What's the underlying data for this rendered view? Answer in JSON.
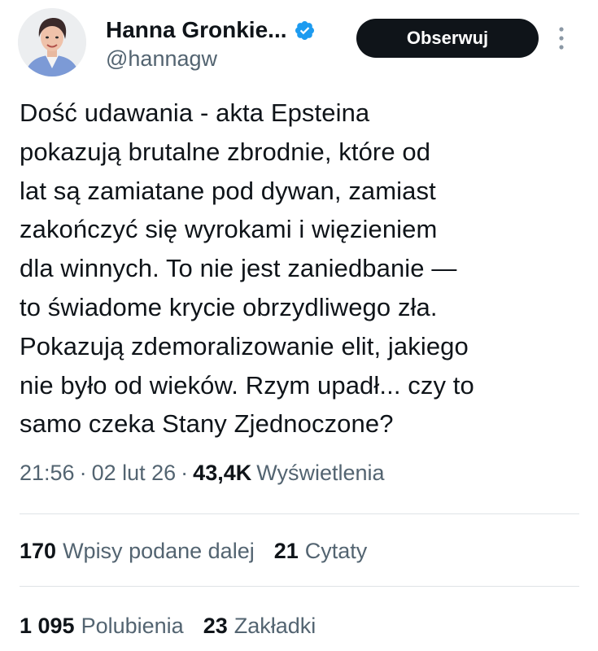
{
  "author": {
    "display_name": "Hanna Gronkie...",
    "handle": "@hannagw",
    "verified_icon": "verified-badge-icon",
    "avatar": "avatar"
  },
  "actions": {
    "follow_label": "Obserwuj",
    "more_icon": "more-vertical-icon"
  },
  "tweet": {
    "lines": [
      "Dość udawania - akta Epsteina",
      "pokazują brutalne zbrodnie, które od",
      "lat są zamiatane pod dywan, zamiast",
      "zakończyć się wyrokami i więzieniem",
      "dla winnych. To nie jest zaniedbanie —",
      "to świadome krycie obrzydliwego zła.",
      "Pokazują zdemoralizowanie elit, jakiego",
      "nie było od wieków. Rzym upadł... czy to",
      "samo czeka Stany Zjednoczone?"
    ]
  },
  "meta": {
    "time": "21:56",
    "separator": "·",
    "date": "02 lut 26",
    "views_count": "43,4K",
    "views_label": "Wyświetlenia"
  },
  "stats": {
    "reposts_count": "170",
    "reposts_label": "Wpisy podane dalej",
    "quotes_count": "21",
    "quotes_label": "Cytaty",
    "likes_count": "1 095",
    "likes_label": "Polubienia",
    "bookmarks_count": "23",
    "bookmarks_label": "Zakładki"
  },
  "colors": {
    "text_primary": "#0f1419",
    "text_secondary": "#536471",
    "verified_blue": "#1d9bf0",
    "button_bg": "#0f1419",
    "divider": "#dfe3e6"
  }
}
